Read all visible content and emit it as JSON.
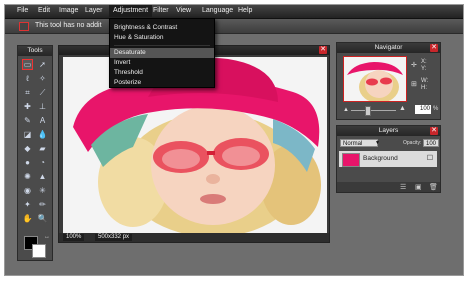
{
  "menu": [
    "File",
    "Edit",
    "Image",
    "Layer",
    "Adjustment",
    "Filter",
    "View",
    "Language",
    "Help"
  ],
  "active_menu": "Adjustment",
  "options_text": "This tool has no addit",
  "adjustment_menu": {
    "items": [
      "Brightness & Contrast",
      "Hue & Saturation",
      "Desaturate",
      "Invert",
      "Threshold",
      "Posterize"
    ],
    "highlighted": "Desaturate"
  },
  "tools_panel": {
    "title": "Tools"
  },
  "canvas": {
    "zoom": "100%",
    "size": "500x332 px"
  },
  "navigator": {
    "title": "Navigator",
    "x_label": "X:",
    "y_label": "Y:",
    "w_label": "W:",
    "h_label": "H:",
    "zoom_value": "100",
    "zoom_unit": "%"
  },
  "layers": {
    "title": "Layers",
    "blend_mode": "Normal",
    "opacity_label": "Opacity:",
    "opacity_value": "100",
    "items": [
      {
        "name": "Background"
      }
    ]
  },
  "colors": {
    "accent_red": "#c8262b",
    "menu_bg": "#222222",
    "workspace": "#6e6e6e"
  }
}
